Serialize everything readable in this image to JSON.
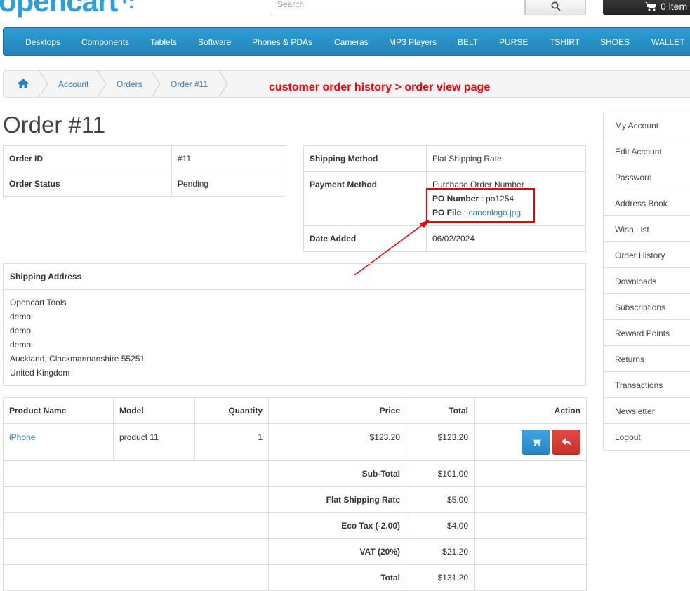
{
  "header": {
    "logo": "opencart",
    "search_placeholder": "Search",
    "cart_label": "0 item"
  },
  "menu": [
    "Desktops",
    "Components",
    "Tablets",
    "Software",
    "Phones & PDAs",
    "Cameras",
    "MP3 Players",
    "BELT",
    "PURSE",
    "TSHIRT",
    "SHOES",
    "WALLET"
  ],
  "breadcrumb": [
    "Account",
    "Orders",
    "Order #11"
  ],
  "annotation": "customer order history > order view page",
  "page_title": "Order #11",
  "order_info": {
    "order_id_label": "Order ID",
    "order_id": "#11",
    "status_label": "Order Status",
    "status": "Pending"
  },
  "shipping_info": {
    "method_label": "Shipping Method",
    "method": "Flat Shipping Rate",
    "payment_label": "Payment Method",
    "payment": "Purchase Order Number",
    "po_number_label": "PO Number",
    "po_number": "po1254",
    "po_file_label": "PO File",
    "po_file": "canonlogo.jpg",
    "date_label": "Date Added",
    "date": "06/02/2024"
  },
  "address": {
    "heading": "Shipping Address",
    "lines": [
      "Opencart Tools",
      "demo",
      "demo",
      "demo",
      "Auckland, Clackmannanshire 55251",
      "United Kingdom"
    ]
  },
  "products": {
    "headers": [
      "Product Name",
      "Model",
      "Quantity",
      "Price",
      "Total",
      "Action"
    ],
    "rows": [
      {
        "name": "iPhone",
        "model": "product 11",
        "quantity": "1",
        "price": "$123.20",
        "total": "$123.20"
      }
    ],
    "totals": [
      {
        "label": "Sub-Total",
        "value": "$101.00"
      },
      {
        "label": "Flat Shipping Rate",
        "value": "$5.00"
      },
      {
        "label": "Eco Tax (-2.00)",
        "value": "$4.00"
      },
      {
        "label": "VAT (20%)",
        "value": "$21.20"
      },
      {
        "label": "Total",
        "value": "$131.20"
      }
    ]
  },
  "sidebar": [
    "My Account",
    "Edit Account",
    "Password",
    "Address Book",
    "Wish List",
    "Order History",
    "Downloads",
    "Subscriptions",
    "Reward Points",
    "Returns",
    "Transactions",
    "Newsletter",
    "Logout"
  ],
  "colors": {
    "brand": "#2d9fd9",
    "menu": "#2581b9",
    "annotation": "#ff0000",
    "button_blue": "#2a84c2",
    "button_red": "#c8302a"
  }
}
